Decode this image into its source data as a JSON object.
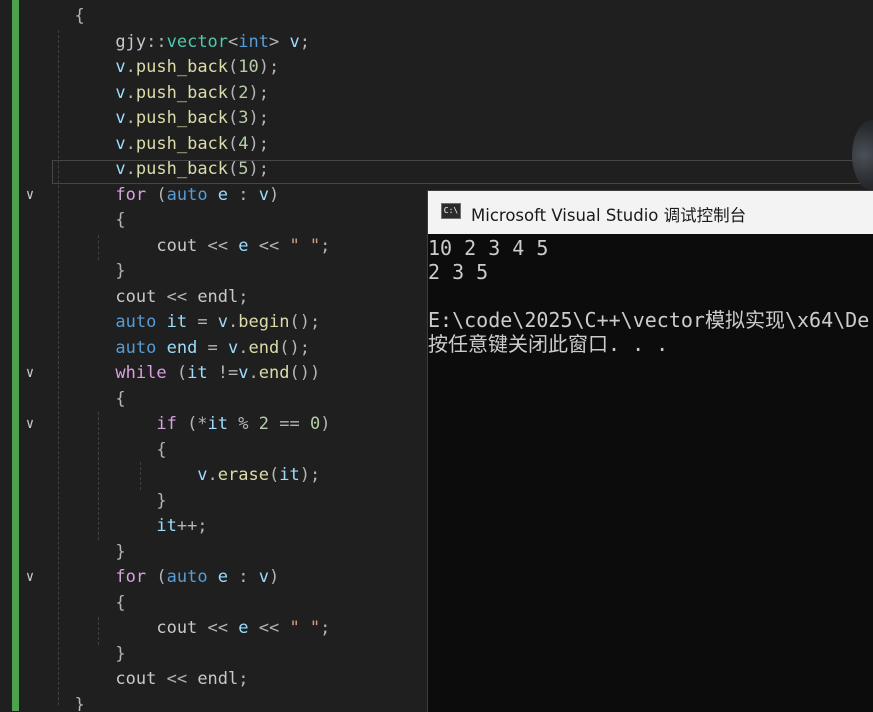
{
  "console": {
    "title": "Microsoft Visual Studio 调试控制台",
    "icon_label": "C:\\",
    "output_lines": [
      "10 2 3 4 5",
      "2 3 5",
      "",
      "E:\\code\\2025\\C++\\vector模拟实现\\x64\\De",
      "按任意键关闭此窗口. . ."
    ]
  },
  "editor": {
    "fold_glyph": "∨",
    "lines": [
      {
        "tokens": [
          {
            "t": "  {",
            "c": "op"
          }
        ]
      },
      {
        "tokens": [
          {
            "t": "      gjy",
            "c": "ns"
          },
          {
            "t": "::",
            "c": "op"
          },
          {
            "t": "vector",
            "c": "type"
          },
          {
            "t": "<",
            "c": "op"
          },
          {
            "t": "int",
            "c": "kw"
          },
          {
            "t": "> ",
            "c": "op"
          },
          {
            "t": "v",
            "c": "var"
          },
          {
            "t": ";",
            "c": "op"
          }
        ]
      },
      {
        "tokens": [
          {
            "t": "      v",
            "c": "var"
          },
          {
            "t": ".",
            "c": "op"
          },
          {
            "t": "push_back",
            "c": "fn"
          },
          {
            "t": "(",
            "c": "op"
          },
          {
            "t": "10",
            "c": "num"
          },
          {
            "t": ");",
            "c": "op"
          }
        ]
      },
      {
        "tokens": [
          {
            "t": "      v",
            "c": "var"
          },
          {
            "t": ".",
            "c": "op"
          },
          {
            "t": "push_back",
            "c": "fn"
          },
          {
            "t": "(",
            "c": "op"
          },
          {
            "t": "2",
            "c": "num"
          },
          {
            "t": ");",
            "c": "op"
          }
        ]
      },
      {
        "tokens": [
          {
            "t": "      v",
            "c": "var"
          },
          {
            "t": ".",
            "c": "op"
          },
          {
            "t": "push_back",
            "c": "fn"
          },
          {
            "t": "(",
            "c": "op"
          },
          {
            "t": "3",
            "c": "num"
          },
          {
            "t": ");",
            "c": "op"
          }
        ]
      },
      {
        "tokens": [
          {
            "t": "      v",
            "c": "var"
          },
          {
            "t": ".",
            "c": "op"
          },
          {
            "t": "push_back",
            "c": "fn"
          },
          {
            "t": "(",
            "c": "op"
          },
          {
            "t": "4",
            "c": "num"
          },
          {
            "t": ");",
            "c": "op"
          }
        ]
      },
      {
        "tokens": [
          {
            "t": "      v",
            "c": "var"
          },
          {
            "t": ".",
            "c": "op"
          },
          {
            "t": "push_back",
            "c": "fn"
          },
          {
            "t": "(",
            "c": "op"
          },
          {
            "t": "5",
            "c": "num"
          },
          {
            "t": ");",
            "c": "op"
          }
        ]
      },
      {
        "fold": true,
        "tokens": [
          {
            "t": "      for",
            "c": "ctrl"
          },
          {
            "t": " (",
            "c": "op"
          },
          {
            "t": "auto",
            "c": "kw"
          },
          {
            "t": " e",
            "c": "var"
          },
          {
            "t": " : ",
            "c": "op"
          },
          {
            "t": "v",
            "c": "var"
          },
          {
            "t": ")",
            "c": "op"
          }
        ]
      },
      {
        "tokens": [
          {
            "t": "      {",
            "c": "op"
          }
        ]
      },
      {
        "tokens": [
          {
            "t": "          cout",
            "c": "ns"
          },
          {
            "t": " << ",
            "c": "op"
          },
          {
            "t": "e",
            "c": "var"
          },
          {
            "t": " << ",
            "c": "op"
          },
          {
            "t": "\" \"",
            "c": "str"
          },
          {
            "t": ";",
            "c": "op"
          }
        ]
      },
      {
        "tokens": [
          {
            "t": "      }",
            "c": "op"
          }
        ]
      },
      {
        "tokens": [
          {
            "t": "      cout",
            "c": "ns"
          },
          {
            "t": " << ",
            "c": "op"
          },
          {
            "t": "endl",
            "c": "ns"
          },
          {
            "t": ";",
            "c": "op"
          }
        ]
      },
      {
        "tokens": [
          {
            "t": "      auto",
            "c": "kw"
          },
          {
            "t": " it",
            "c": "var"
          },
          {
            "t": " = ",
            "c": "op"
          },
          {
            "t": "v",
            "c": "var"
          },
          {
            "t": ".",
            "c": "op"
          },
          {
            "t": "begin",
            "c": "fn"
          },
          {
            "t": "();",
            "c": "op"
          }
        ]
      },
      {
        "tokens": [
          {
            "t": "      auto",
            "c": "kw"
          },
          {
            "t": " end",
            "c": "var"
          },
          {
            "t": " = ",
            "c": "op"
          },
          {
            "t": "v",
            "c": "var"
          },
          {
            "t": ".",
            "c": "op"
          },
          {
            "t": "end",
            "c": "fn"
          },
          {
            "t": "();",
            "c": "op"
          }
        ]
      },
      {
        "fold": true,
        "tokens": [
          {
            "t": "      while",
            "c": "ctrl"
          },
          {
            "t": " (",
            "c": "op"
          },
          {
            "t": "it",
            "c": "var"
          },
          {
            "t": " !=",
            "c": "op"
          },
          {
            "t": "v",
            "c": "var"
          },
          {
            "t": ".",
            "c": "op"
          },
          {
            "t": "end",
            "c": "fn"
          },
          {
            "t": "())",
            "c": "op"
          }
        ]
      },
      {
        "tokens": [
          {
            "t": "      {",
            "c": "op"
          }
        ]
      },
      {
        "fold": true,
        "tokens": [
          {
            "t": "          if",
            "c": "ctrl"
          },
          {
            "t": " (*",
            "c": "op"
          },
          {
            "t": "it",
            "c": "var"
          },
          {
            "t": " % ",
            "c": "op"
          },
          {
            "t": "2",
            "c": "num"
          },
          {
            "t": " == ",
            "c": "op"
          },
          {
            "t": "0",
            "c": "num"
          },
          {
            "t": ")",
            "c": "op"
          }
        ]
      },
      {
        "tokens": [
          {
            "t": "          {",
            "c": "op"
          }
        ]
      },
      {
        "tokens": [
          {
            "t": "              v",
            "c": "var"
          },
          {
            "t": ".",
            "c": "op"
          },
          {
            "t": "erase",
            "c": "fn"
          },
          {
            "t": "(",
            "c": "op"
          },
          {
            "t": "it",
            "c": "var"
          },
          {
            "t": ");",
            "c": "op"
          }
        ]
      },
      {
        "tokens": [
          {
            "t": "          }",
            "c": "op"
          }
        ]
      },
      {
        "tokens": [
          {
            "t": "          it",
            "c": "var"
          },
          {
            "t": "++;",
            "c": "op"
          }
        ]
      },
      {
        "tokens": [
          {
            "t": "      }",
            "c": "op"
          }
        ]
      },
      {
        "fold": true,
        "tokens": [
          {
            "t": "      for",
            "c": "ctrl"
          },
          {
            "t": " (",
            "c": "op"
          },
          {
            "t": "auto",
            "c": "kw"
          },
          {
            "t": " e",
            "c": "var"
          },
          {
            "t": " : ",
            "c": "op"
          },
          {
            "t": "v",
            "c": "var"
          },
          {
            "t": ")",
            "c": "op"
          }
        ]
      },
      {
        "tokens": [
          {
            "t": "      {",
            "c": "op"
          }
        ]
      },
      {
        "tokens": [
          {
            "t": "          cout",
            "c": "ns"
          },
          {
            "t": " << ",
            "c": "op"
          },
          {
            "t": "e",
            "c": "var"
          },
          {
            "t": " << ",
            "c": "op"
          },
          {
            "t": "\" \"",
            "c": "str"
          },
          {
            "t": ";",
            "c": "op"
          }
        ]
      },
      {
        "tokens": [
          {
            "t": "      }",
            "c": "op"
          }
        ]
      },
      {
        "tokens": [
          {
            "t": "      cout",
            "c": "ns"
          },
          {
            "t": " << ",
            "c": "op"
          },
          {
            "t": "endl",
            "c": "ns"
          },
          {
            "t": ";",
            "c": "op"
          }
        ]
      },
      {
        "tokens": [
          {
            "t": "  }",
            "c": "op"
          }
        ]
      }
    ]
  }
}
